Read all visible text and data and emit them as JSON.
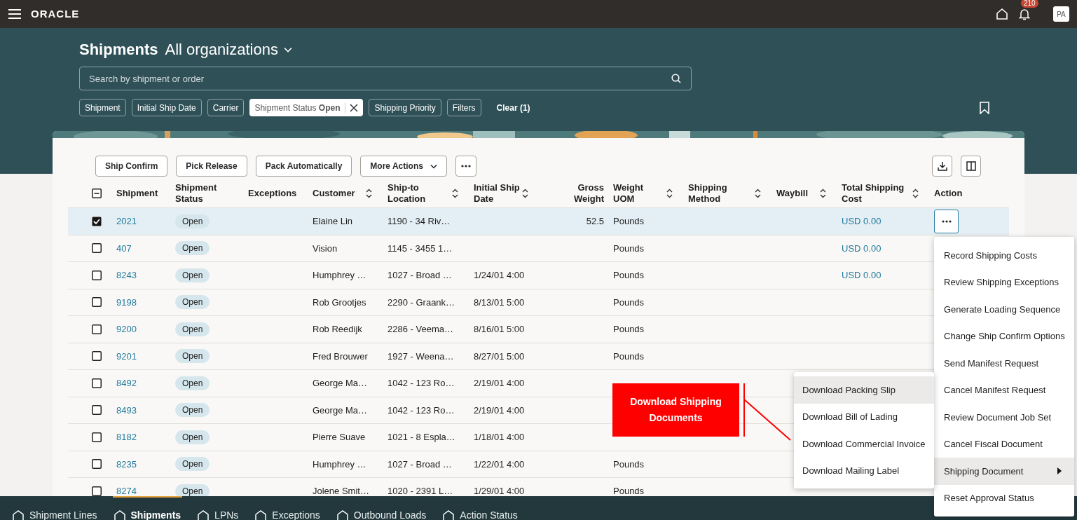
{
  "top_bar": {
    "logo": "ORACLE",
    "notification_count": "210",
    "avatar_initials": "PA"
  },
  "page": {
    "title": "Shipments",
    "scope": "All organizations"
  },
  "search": {
    "placeholder": "Search by shipment or order"
  },
  "filter_chips": [
    {
      "label": "Shipment",
      "active": false
    },
    {
      "label": "Initial Ship Date",
      "active": false
    },
    {
      "label": "Carrier",
      "active": false
    },
    {
      "label": "Shipment Status **Open**",
      "active": true
    },
    {
      "label": "Shipping Priority",
      "active": false
    },
    {
      "label": "Filters",
      "active": false
    }
  ],
  "clear_link": "Clear (1)",
  "toolbar": [
    {
      "kind": "text",
      "label": "Ship Confirm"
    },
    {
      "kind": "text",
      "label": "Pick Release"
    },
    {
      "kind": "text",
      "label": "Pack Automatically"
    },
    {
      "kind": "dropdown",
      "label": "More Actions"
    },
    {
      "kind": "overflow"
    }
  ],
  "table": {
    "select_all_indeterminate": true,
    "columns": [
      {
        "label": "Shipment",
        "sortable": false
      },
      {
        "label": "Shipment Status",
        "sortable": false
      },
      {
        "label": "Exceptions",
        "sortable": false
      },
      {
        "label": "Customer",
        "sortable": true
      },
      {
        "label": "Ship-to Location",
        "sortable": true
      },
      {
        "label": "Initial Ship Date",
        "sortable": true
      },
      {
        "label": "Gross Weight",
        "sortable": false
      },
      {
        "label": "Weight UOM",
        "sortable": true
      },
      {
        "label": "Shipping Method",
        "sortable": true
      },
      {
        "label": "Waybill",
        "sortable": true
      },
      {
        "label": "Total Shipping Cost",
        "sortable": true
      },
      {
        "label": "Action",
        "sortable": false
      }
    ],
    "rows": [
      {
        "selected": true,
        "action_button": true,
        "shipment": "2021",
        "status": "Open",
        "customer": "Elaine Lin",
        "ship_to": "1190 - 34 Riv…",
        "gross_weight": "52.5",
        "weight_uom": "Pounds",
        "total_shipping_cost": "USD 0.00"
      },
      {
        "selected": false,
        "shipment": "407",
        "status": "Open",
        "customer": "Vision",
        "ship_to": "1145 - 3455 1…",
        "weight_uom": "Pounds",
        "total_shipping_cost": "USD 0.00"
      },
      {
        "selected": false,
        "shipment": "8243",
        "status": "Open",
        "customer": "Humphrey …",
        "ship_to": "1027 - Broad …",
        "initial_ship_date": "1/24/01 4:00",
        "weight_uom": "Pounds",
        "total_shipping_cost": "USD 0.00"
      },
      {
        "selected": false,
        "shipment": "9198",
        "status": "Open",
        "customer": "Rob Grootjes",
        "ship_to": "2290 - Graank…",
        "initial_ship_date": "8/13/01 5:00",
        "weight_uom": "Pounds"
      },
      {
        "selected": false,
        "shipment": "9200",
        "status": "Open",
        "customer": "Rob Reedijk",
        "ship_to": "2286 - Veema…",
        "initial_ship_date": "8/16/01 5:00",
        "weight_uom": "Pounds"
      },
      {
        "selected": false,
        "shipment": "9201",
        "status": "Open",
        "customer": "Fred Brouwer",
        "ship_to": "1927 - Weena…",
        "initial_ship_date": "8/27/01 5:00",
        "weight_uom": "Pounds"
      },
      {
        "selected": false,
        "shipment": "8492",
        "status": "Open",
        "customer": "George Ma…",
        "ship_to": "1042 - 123 Ro…",
        "initial_ship_date": "2/19/01 4:00"
      },
      {
        "selected": false,
        "shipment": "8493",
        "status": "Open",
        "customer": "George Ma…",
        "ship_to": "1042 - 123 Ro…",
        "initial_ship_date": "2/19/01 4:00"
      },
      {
        "selected": false,
        "shipment": "8182",
        "status": "Open",
        "customer": "Pierre Suave",
        "ship_to": "1021 - 8 Espla…",
        "initial_ship_date": "1/18/01 4:00"
      },
      {
        "selected": false,
        "shipment": "8235",
        "status": "Open",
        "customer": "Humphrey …",
        "ship_to": "1027 - Broad …",
        "initial_ship_date": "1/22/01 4:00",
        "weight_uom": "Pounds"
      },
      {
        "selected": false,
        "shipment": "8274",
        "status": "Open",
        "customer": "Jolene Smit…",
        "ship_to": "1020 - 2391 L…",
        "initial_ship_date": "1/29/01 4:00",
        "weight_uom": "Pounds"
      }
    ]
  },
  "row_menu": [
    {
      "label": "Record Shipping Costs",
      "selected": false,
      "submenu": false
    },
    {
      "label": "Review Shipping Exceptions",
      "selected": false,
      "submenu": false
    },
    {
      "label": "Generate Loading Sequence",
      "selected": false,
      "submenu": false
    },
    {
      "label": "Change Ship Confirm Options",
      "selected": false,
      "submenu": false
    },
    {
      "label": "Send Manifest Request",
      "selected": false,
      "submenu": false
    },
    {
      "label": "Cancel Manifest Request",
      "selected": false,
      "submenu": false
    },
    {
      "label": "Review Document Job Set",
      "selected": false,
      "submenu": false
    },
    {
      "label": "Cancel Fiscal Document",
      "selected": false,
      "submenu": false
    },
    {
      "label": "Shipping Document",
      "selected": true,
      "submenu": true
    },
    {
      "label": "Reset Approval Status",
      "selected": false,
      "submenu": false
    }
  ],
  "submenu": [
    {
      "label": "Download Packing Slip",
      "selected": true
    },
    {
      "label": "Download Bill of Lading",
      "selected": false
    },
    {
      "label": "Download Commercial Invoice",
      "selected": false
    },
    {
      "label": "Download Mailing Label",
      "selected": false
    }
  ],
  "callout": {
    "text": "Download Shipping Documents"
  },
  "bottom_tabs": [
    {
      "label": "Shipment Lines",
      "selected": false
    },
    {
      "label": "Shipments",
      "selected": true
    },
    {
      "label": "LPNs",
      "selected": false
    },
    {
      "label": "Exceptions",
      "selected": false
    },
    {
      "label": "Outbound Loads",
      "selected": false
    },
    {
      "label": "Action Status",
      "selected": false
    }
  ]
}
